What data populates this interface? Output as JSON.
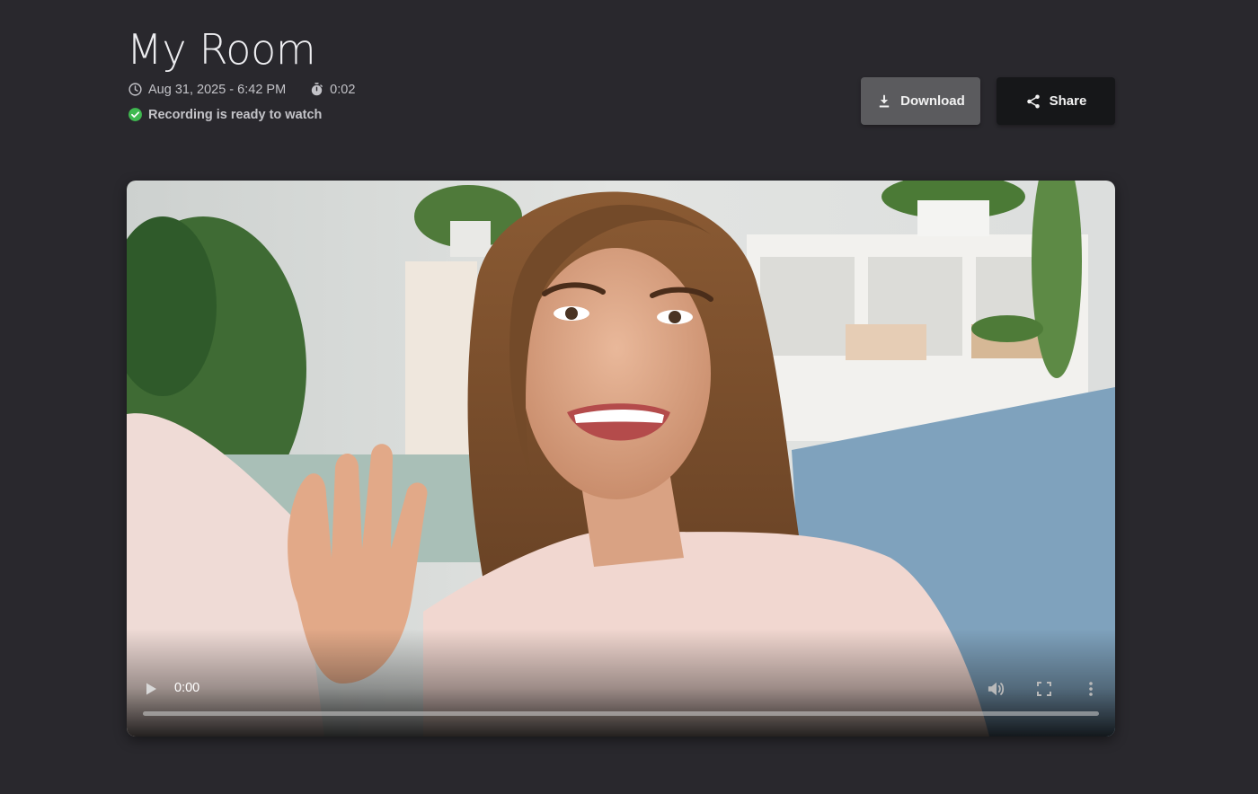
{
  "recording": {
    "title": "My Room",
    "date": "Aug 31, 2025 - 6:42 PM",
    "duration": "0:02",
    "status": "Recording is ready to watch",
    "status_color": "#3fb950"
  },
  "actions": {
    "download_label": "Download",
    "share_label": "Share"
  },
  "player": {
    "current_time": "0:00",
    "progress": 0.0
  },
  "icons": {
    "date": "clock-icon",
    "duration": "stopwatch-icon",
    "status": "check-circle-icon",
    "download": "download-icon",
    "share": "share-icon",
    "play": "play-icon",
    "volume": "volume-icon",
    "fullscreen": "fullscreen-icon",
    "more": "more-vertical-icon"
  }
}
